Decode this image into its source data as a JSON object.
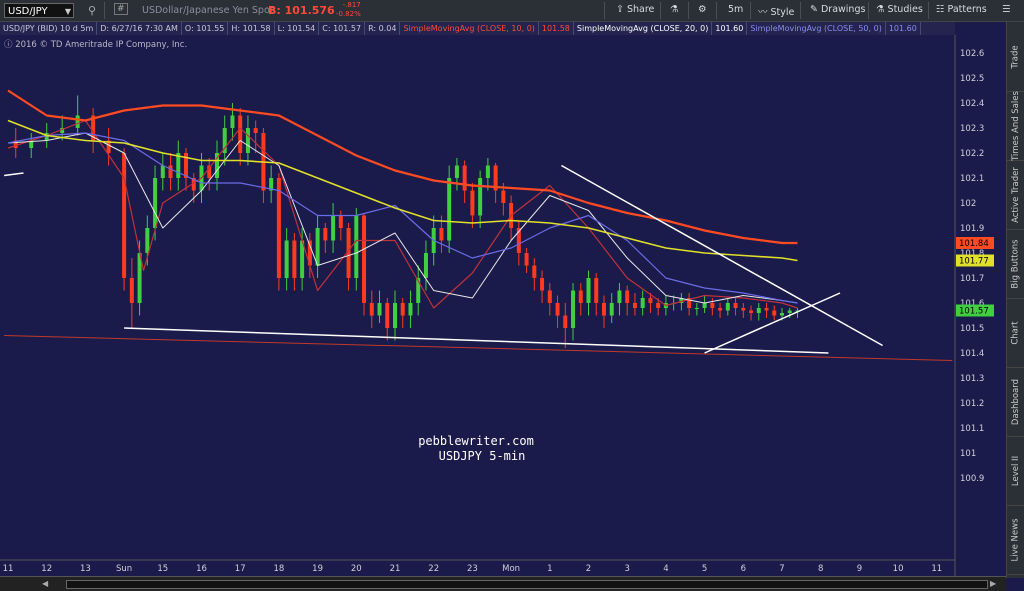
{
  "topbar": {
    "symbol": "USD/JPY",
    "description": "USDollar/Japanese Yen Spot",
    "bid": "B: 101.576",
    "change": "-.817",
    "change_pct": "-0.82%",
    "share_label": "Share",
    "timeframe_label": "5m",
    "style_label": "Style",
    "drawings_label": "Drawings",
    "studies_label": "Studies",
    "patterns_label": "Patterns"
  },
  "infobar": {
    "symbol_info": "USD/JPY (BID) 10 d 5m",
    "date": "D: 6/27/16 7:30 AM",
    "open": "O: 101.55",
    "high": "H: 101.58",
    "low": "L: 101.54",
    "close": "C: 101.57",
    "range": "R: 0.04",
    "sma10_label": "SimpleMovingAvg (CLOSE, 10, 0)",
    "sma10_value": "101.58",
    "sma20_label": "SimpleMovingAvg (CLOSE, 20, 0)",
    "sma20_value": "101.60",
    "sma50_label": "SimpleMovingAvg (CLOSE, 50, 0)",
    "sma50_value": "101.60"
  },
  "copyright": "2016 © TD Ameritrade IP Company, Inc.",
  "watermark": {
    "line1": "pebblewriter.com",
    "line2": "USDJPY 5-min"
  },
  "sidebar": {
    "tabs": [
      "Trade",
      "Times And Sales",
      "Active Trader",
      "Big Buttons",
      "Chart",
      "Dashboard",
      "Level II",
      "Live News"
    ]
  },
  "colors": {
    "background": "#1a1b4a",
    "candle_up": "#3fcf3f",
    "candle_down": "#ff3a1f",
    "sma10": "#c0313a",
    "sma20": "#e8e8e8",
    "sma50": "#6b6be8",
    "sma_long_yellow": "#e0e02a",
    "sma_long_red": "#ff4a22",
    "trendline": "#ffffff",
    "horizontal_line": "#c0392b"
  },
  "chart_data": {
    "type": "candlestick",
    "title": "",
    "y_axis_side": "right",
    "ylim": [
      100.86,
      102.69
    ],
    "yticks": [
      100.9,
      101,
      101.1,
      101.2,
      101.3,
      101.4,
      101.5,
      101.6,
      101.7,
      101.8,
      101.9,
      102,
      102.1,
      102.2,
      102.3,
      102.4,
      102.5,
      102.6
    ],
    "ytick_labels": [
      "100.9",
      "101",
      "101.1",
      "101.2",
      "101.3",
      "101.4",
      "101.5",
      "101.6",
      "101.7",
      "101.8",
      "101.9",
      "102",
      "102.1",
      "102.2",
      "102.3",
      "102.4",
      "102.5",
      "102.6"
    ],
    "x_labels": [
      "11",
      "12",
      "13",
      "Sun",
      "15",
      "16",
      "17",
      "18",
      "19",
      "20",
      "21",
      "22",
      "23",
      "Mon",
      "1",
      "2",
      "3",
      "4",
      "5",
      "6",
      "7",
      "8",
      "9",
      "10",
      "11"
    ],
    "x_label_index": [
      0,
      1,
      2,
      3,
      4,
      5,
      6,
      7,
      8,
      9,
      10,
      11,
      12,
      13,
      14,
      15,
      16,
      17,
      18,
      19,
      20,
      21,
      22,
      23,
      24
    ],
    "price_tags": [
      {
        "label": "101.84",
        "value": 101.84,
        "color": "#ff4a22"
      },
      {
        "label": "101.77",
        "value": 101.77,
        "color": "#e0e02a"
      },
      {
        "label": "101.57",
        "value": 101.57,
        "color": "#3fcf3f"
      }
    ],
    "series": [
      {
        "name": "SimpleMovingAvg (CLOSE, 10, 0)",
        "color": "#c0313a",
        "x": [
          0,
          1,
          2,
          3,
          3.5,
          4,
          5,
          6,
          7,
          8,
          9,
          10,
          11,
          12,
          13,
          14,
          15,
          16,
          17,
          18,
          19,
          20,
          20.4
        ],
        "y": [
          102.22,
          102.27,
          102.33,
          102.1,
          101.73,
          102.0,
          102.1,
          102.3,
          102.15,
          101.65,
          101.85,
          101.85,
          101.58,
          101.72,
          101.95,
          102.07,
          101.9,
          101.7,
          101.59,
          101.63,
          101.62,
          101.6,
          101.58
        ]
      },
      {
        "name": "SimpleMovingAvg (CLOSE, 20, 0)",
        "color": "#e8e8e8",
        "x": [
          0,
          1,
          2,
          3,
          4,
          5,
          6,
          7,
          8,
          9,
          10,
          11,
          12,
          13,
          14,
          15,
          16,
          17,
          18,
          19,
          20,
          20.4
        ],
        "y": [
          102.24,
          102.25,
          102.28,
          102.2,
          101.9,
          102.05,
          102.25,
          102.15,
          101.75,
          101.8,
          101.88,
          101.65,
          101.62,
          101.85,
          102.03,
          101.97,
          101.78,
          101.63,
          101.6,
          101.63,
          101.61,
          101.6
        ]
      },
      {
        "name": "SimpleMovingAvg (CLOSE, 50, 0)",
        "color": "#6b6be8",
        "x": [
          0,
          1,
          2,
          3,
          4,
          5,
          6,
          7,
          8,
          9,
          10,
          11,
          12,
          13,
          14,
          15,
          16,
          17,
          18,
          19,
          20,
          20.4
        ],
        "y": [
          102.24,
          102.27,
          102.28,
          102.25,
          102.15,
          102.08,
          102.08,
          102.05,
          101.95,
          101.95,
          101.99,
          101.85,
          101.78,
          101.82,
          101.9,
          101.95,
          101.85,
          101.7,
          101.66,
          101.64,
          101.61,
          101.6
        ]
      },
      {
        "name": "Yellow moving average",
        "color": "#e0e02a",
        "x": [
          0,
          1,
          2,
          3,
          4,
          5,
          6,
          7,
          8,
          9,
          10,
          11,
          12,
          13,
          14,
          15,
          16,
          17,
          18,
          19,
          20,
          20.4
        ],
        "y": [
          102.33,
          102.27,
          102.25,
          102.24,
          102.2,
          102.17,
          102.17,
          102.16,
          102.1,
          102.04,
          101.98,
          101.93,
          101.92,
          101.93,
          101.92,
          101.9,
          101.86,
          101.82,
          101.8,
          101.79,
          101.78,
          101.77
        ]
      },
      {
        "name": "Red moving average",
        "color": "#ff4a22",
        "x": [
          0,
          1,
          2,
          3,
          4,
          5,
          6,
          7,
          8,
          9,
          10,
          11,
          12,
          13,
          14,
          15,
          16,
          17,
          18,
          19,
          20,
          20.4
        ],
        "y": [
          102.45,
          102.35,
          102.33,
          102.37,
          102.39,
          102.39,
          102.37,
          102.35,
          102.27,
          102.19,
          102.13,
          102.09,
          102.07,
          102.06,
          102.05,
          102.0,
          101.96,
          101.93,
          101.89,
          101.86,
          101.84,
          101.84
        ]
      }
    ],
    "candles": {
      "x": [
        0.2,
        0.6,
        1.0,
        1.4,
        1.8,
        2.2,
        2.6,
        3.0,
        3.2,
        3.4,
        3.6,
        3.8,
        4.0,
        4.2,
        4.4,
        4.6,
        4.8,
        5.0,
        5.2,
        5.4,
        5.6,
        5.8,
        6.0,
        6.2,
        6.4,
        6.6,
        6.8,
        7.0,
        7.2,
        7.4,
        7.6,
        7.8,
        8.0,
        8.2,
        8.4,
        8.6,
        8.8,
        9.0,
        9.2,
        9.4,
        9.6,
        9.8,
        10.0,
        10.2,
        10.4,
        10.6,
        10.8,
        11.0,
        11.2,
        11.4,
        11.6,
        11.8,
        12.0,
        12.2,
        12.4,
        12.6,
        12.8,
        13.0,
        13.2,
        13.4,
        13.6,
        13.8,
        14.0,
        14.2,
        14.4,
        14.6,
        14.8,
        15.0,
        15.2,
        15.4,
        15.6,
        15.8,
        16.0,
        16.2,
        16.4,
        16.6,
        16.8,
        17.0,
        17.2,
        17.4,
        17.6,
        17.8,
        18.0,
        18.2,
        18.4,
        18.6,
        18.8,
        19.0,
        19.2,
        19.4,
        19.6,
        19.8,
        20.0,
        20.2,
        20.4
      ],
      "open": [
        102.25,
        102.22,
        102.25,
        102.28,
        102.3,
        102.35,
        102.25,
        102.2,
        101.7,
        101.6,
        101.8,
        101.9,
        102.1,
        102.15,
        102.1,
        102.2,
        102.1,
        102.05,
        102.15,
        102.1,
        102.2,
        102.3,
        102.35,
        102.2,
        102.3,
        102.28,
        102.05,
        102.1,
        101.7,
        101.85,
        101.7,
        101.85,
        101.75,
        101.9,
        101.85,
        101.95,
        101.9,
        101.7,
        101.95,
        101.6,
        101.55,
        101.6,
        101.5,
        101.6,
        101.55,
        101.6,
        101.7,
        101.8,
        101.9,
        101.85,
        102.1,
        102.15,
        102.05,
        101.95,
        102.1,
        102.15,
        102.05,
        102.0,
        101.9,
        101.8,
        101.75,
        101.7,
        101.65,
        101.6,
        101.55,
        101.5,
        101.65,
        101.6,
        101.7,
        101.6,
        101.55,
        101.6,
        101.65,
        101.6,
        101.58,
        101.62,
        101.6,
        101.58,
        101.6,
        101.6,
        101.62,
        101.58,
        101.58,
        101.6,
        101.58,
        101.57,
        101.6,
        101.58,
        101.57,
        101.56,
        101.58,
        101.57,
        101.55,
        101.56,
        101.57
      ],
      "close": [
        102.22,
        102.25,
        102.28,
        102.3,
        102.35,
        102.25,
        102.2,
        101.7,
        101.6,
        101.8,
        101.9,
        102.1,
        102.15,
        102.1,
        102.2,
        102.1,
        102.05,
        102.15,
        102.1,
        102.2,
        102.3,
        102.35,
        102.2,
        102.3,
        102.28,
        102.05,
        102.1,
        101.7,
        101.85,
        101.7,
        101.85,
        101.75,
        101.9,
        101.85,
        101.95,
        101.9,
        101.7,
        101.95,
        101.6,
        101.55,
        101.6,
        101.5,
        101.6,
        101.55,
        101.6,
        101.7,
        101.8,
        101.9,
        101.85,
        102.1,
        102.15,
        102.05,
        101.95,
        102.1,
        102.15,
        102.05,
        102.0,
        101.9,
        101.8,
        101.75,
        101.7,
        101.65,
        101.6,
        101.55,
        101.5,
        101.65,
        101.6,
        101.7,
        101.6,
        101.55,
        101.6,
        101.65,
        101.6,
        101.58,
        101.62,
        101.6,
        101.58,
        101.6,
        101.6,
        101.62,
        101.58,
        101.58,
        101.6,
        101.58,
        101.57,
        101.6,
        101.58,
        101.57,
        101.56,
        101.58,
        101.57,
        101.55,
        101.56,
        101.57,
        101.57
      ],
      "high": [
        102.3,
        102.28,
        102.32,
        102.35,
        102.43,
        102.38,
        102.3,
        102.22,
        101.78,
        101.85,
        101.95,
        102.15,
        102.2,
        102.2,
        102.25,
        102.22,
        102.12,
        102.2,
        102.18,
        102.25,
        102.35,
        102.4,
        102.38,
        102.35,
        102.33,
        102.3,
        102.15,
        102.12,
        101.9,
        101.88,
        101.9,
        101.88,
        101.95,
        101.92,
        102.0,
        101.97,
        101.92,
        101.98,
        101.96,
        101.65,
        101.65,
        101.62,
        101.65,
        101.62,
        101.65,
        101.75,
        101.85,
        101.95,
        101.95,
        102.15,
        102.18,
        102.17,
        102.08,
        102.13,
        102.18,
        102.16,
        102.08,
        102.03,
        101.93,
        101.82,
        101.78,
        101.73,
        101.68,
        101.63,
        101.6,
        101.68,
        101.68,
        101.73,
        101.72,
        101.63,
        101.64,
        101.68,
        101.67,
        101.64,
        101.65,
        101.64,
        101.62,
        101.63,
        101.63,
        101.64,
        101.64,
        101.6,
        101.63,
        101.62,
        101.6,
        101.62,
        101.62,
        101.6,
        101.59,
        101.6,
        101.6,
        101.59,
        101.58,
        101.58,
        101.58
      ],
      "low": [
        102.18,
        102.18,
        102.22,
        102.25,
        102.27,
        102.2,
        102.15,
        101.65,
        101.5,
        101.55,
        101.75,
        101.85,
        102.05,
        102.05,
        102.05,
        102.05,
        102.0,
        102.0,
        102.05,
        102.05,
        102.15,
        102.25,
        102.15,
        102.15,
        102.2,
        102.0,
        102.0,
        101.65,
        101.65,
        101.65,
        101.65,
        101.7,
        101.7,
        101.8,
        101.8,
        101.85,
        101.65,
        101.65,
        101.55,
        101.5,
        101.52,
        101.45,
        101.45,
        101.5,
        101.5,
        101.55,
        101.65,
        101.75,
        101.8,
        101.8,
        102.05,
        102.0,
        101.9,
        101.9,
        102.05,
        102.0,
        101.95,
        101.85,
        101.75,
        101.72,
        101.65,
        101.6,
        101.55,
        101.5,
        101.42,
        101.45,
        101.55,
        101.55,
        101.55,
        101.5,
        101.52,
        101.55,
        101.55,
        101.55,
        101.55,
        101.56,
        101.55,
        101.55,
        101.57,
        101.57,
        101.55,
        101.55,
        101.56,
        101.55,
        101.54,
        101.55,
        101.55,
        101.54,
        101.53,
        101.53,
        101.54,
        101.53,
        101.53,
        101.54,
        101.54
      ]
    },
    "trendlines": [
      {
        "x": [
          3.0,
          21.2
        ],
        "y": [
          101.5,
          101.4
        ]
      },
      {
        "x": [
          18.0,
          21.5
        ],
        "y": [
          101.4,
          101.64
        ]
      },
      {
        "x": [
          14.3,
          22.6
        ],
        "y": [
          102.15,
          101.43
        ]
      },
      {
        "x": [
          -0.1,
          0.4
        ],
        "y": [
          102.11,
          102.12
        ]
      }
    ],
    "horizontal_line": {
      "x": [
        -0.1,
        24.4
      ],
      "y": [
        101.47,
        101.37
      ]
    },
    "grid": false,
    "legend": "none"
  }
}
